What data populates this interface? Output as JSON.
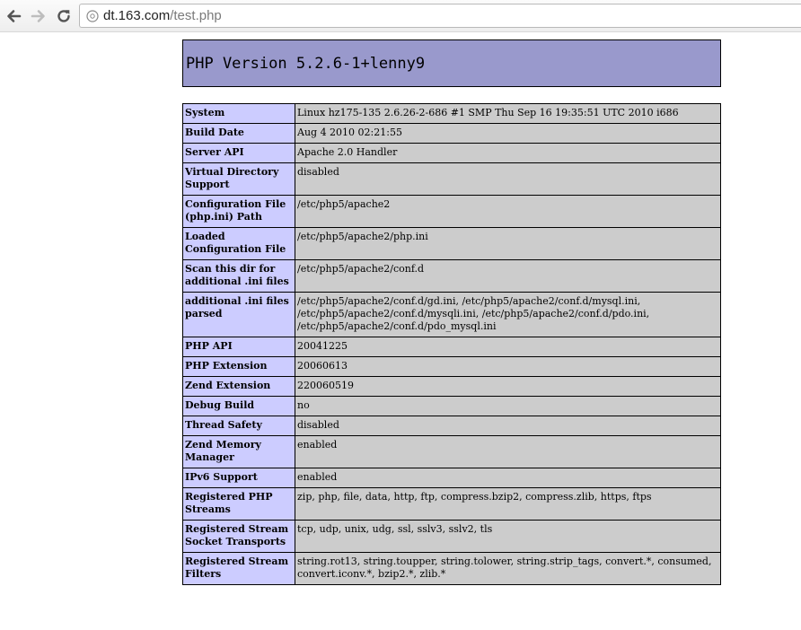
{
  "browser": {
    "url_host": "dt.163.com",
    "url_path": "/test.php",
    "icons": [
      "back-arrow-icon",
      "forward-arrow-icon",
      "reload-icon",
      "page-icon"
    ]
  },
  "page": {
    "title": "PHP Version 5.2.6-1+lenny9",
    "rows": [
      {
        "label": "System",
        "value": "Linux hz175-135 2.6.26-2-686 #1 SMP Thu Sep 16 19:35:51 UTC 2010 i686"
      },
      {
        "label": "Build Date",
        "value": "Aug 4 2010 02:21:55"
      },
      {
        "label": "Server API",
        "value": "Apache 2.0 Handler"
      },
      {
        "label": "Virtual Directory Support",
        "value": "disabled"
      },
      {
        "label": "Configuration File (php.ini) Path",
        "value": "/etc/php5/apache2"
      },
      {
        "label": "Loaded Configuration File",
        "value": "/etc/php5/apache2/php.ini"
      },
      {
        "label": "Scan this dir for additional .ini files",
        "value": "/etc/php5/apache2/conf.d"
      },
      {
        "label": "additional .ini files parsed",
        "value": "/etc/php5/apache2/conf.d/gd.ini, /etc/php5/apache2/conf.d/mysql.ini, /etc/php5/apache2/conf.d/mysqli.ini, /etc/php5/apache2/conf.d/pdo.ini, /etc/php5/apache2/conf.d/pdo_mysql.ini"
      },
      {
        "label": "PHP API",
        "value": "20041225"
      },
      {
        "label": "PHP Extension",
        "value": "20060613"
      },
      {
        "label": "Zend Extension",
        "value": "220060519"
      },
      {
        "label": "Debug Build",
        "value": "no"
      },
      {
        "label": "Thread Safety",
        "value": "disabled"
      },
      {
        "label": "Zend Memory Manager",
        "value": "enabled"
      },
      {
        "label": "IPv6 Support",
        "value": "enabled"
      },
      {
        "label": "Registered PHP Streams",
        "value": "zip, php, file, data, http, ftp, compress.bzip2, compress.zlib, https, ftps"
      },
      {
        "label": "Registered Stream Socket Transports",
        "value": "tcp, udp, unix, udg, ssl, sslv3, sslv2, tls"
      },
      {
        "label": "Registered Stream Filters",
        "value": "string.rot13, string.toupper, string.tolower, string.strip_tags, convert.*, consumed, convert.iconv.*, bzip2.*, zlib.*"
      }
    ]
  },
  "colors": {
    "header_bg": "#9999cc",
    "label_bg": "#ccccff",
    "value_bg": "#cccccc"
  }
}
